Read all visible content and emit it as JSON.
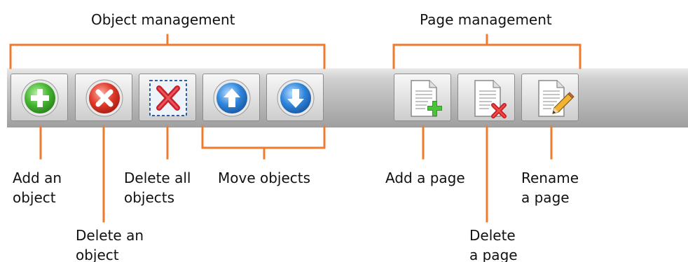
{
  "headers": {
    "object_management": "Object management",
    "page_management": "Page management"
  },
  "buttons": {
    "add_object": {
      "icon": "plus-circle-icon",
      "color": "#3fae2a"
    },
    "delete_object": {
      "icon": "x-circle-icon",
      "color": "#d93a2b"
    },
    "delete_all_objects": {
      "icon": "x-dashed-box-icon",
      "color": "#c8202a"
    },
    "move_up": {
      "icon": "arrow-up-circle-icon",
      "color": "#2a7ad0"
    },
    "move_down": {
      "icon": "arrow-down-circle-icon",
      "color": "#2a7ad0"
    },
    "add_page": {
      "icon": "page-plus-icon",
      "color": "#3fae2a"
    },
    "delete_page": {
      "icon": "page-x-icon",
      "color": "#d32a2a"
    },
    "rename_page": {
      "icon": "page-pencil-icon",
      "color": "#e0a020"
    }
  },
  "labels": {
    "add_object": "Add an\nobject",
    "delete_object": "Delete an\nobject",
    "delete_all_objects": "Delete all\nobjects",
    "move_objects": "Move objects",
    "add_page": "Add a page",
    "delete_page": "Delete\na page",
    "rename_page": "Rename\na page"
  },
  "colors": {
    "callout_line": "#ef7b2e",
    "toolbar": "#b9b9b9"
  }
}
